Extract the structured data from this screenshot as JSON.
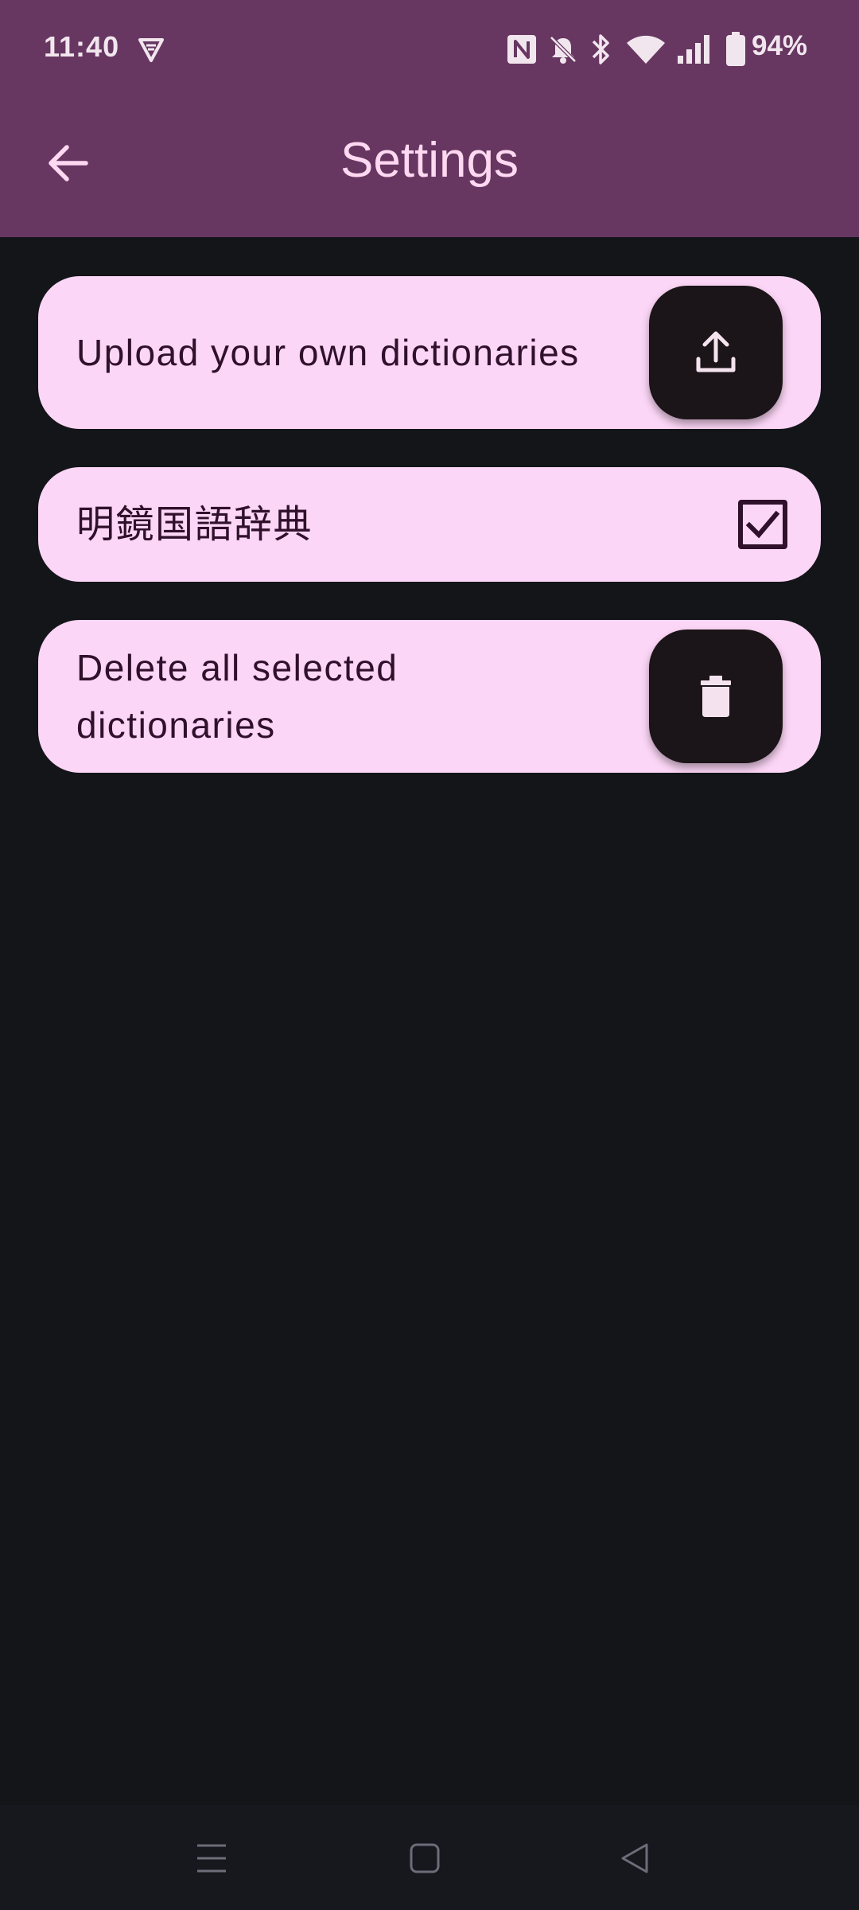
{
  "status_bar": {
    "time": "11:40",
    "battery": "94%",
    "icons": [
      "vpn-shield-icon",
      "nfc-icon",
      "bell-off-icon",
      "bluetooth-icon",
      "wifi-icon",
      "cellular-signal-icon",
      "battery-icon"
    ]
  },
  "app_bar": {
    "title": "Settings",
    "back_icon": "arrow-left-icon"
  },
  "settings": {
    "upload": {
      "label": "Upload your own dictionaries",
      "icon": "upload-icon"
    },
    "dictionaries": [
      {
        "label": "明鏡国語辞典",
        "checked": true
      }
    ],
    "delete": {
      "label": "Delete all selected dictionaries",
      "icon": "trash-icon"
    }
  },
  "nav_bar": {
    "icons": [
      "menu-icon",
      "home-icon",
      "back-triangle-icon"
    ]
  },
  "colors": {
    "header": "#673762",
    "background": "#141519",
    "card": "#fcd6f6",
    "card_text": "#30112c",
    "fab": "#1b1418",
    "title": "#ffd8f1"
  }
}
